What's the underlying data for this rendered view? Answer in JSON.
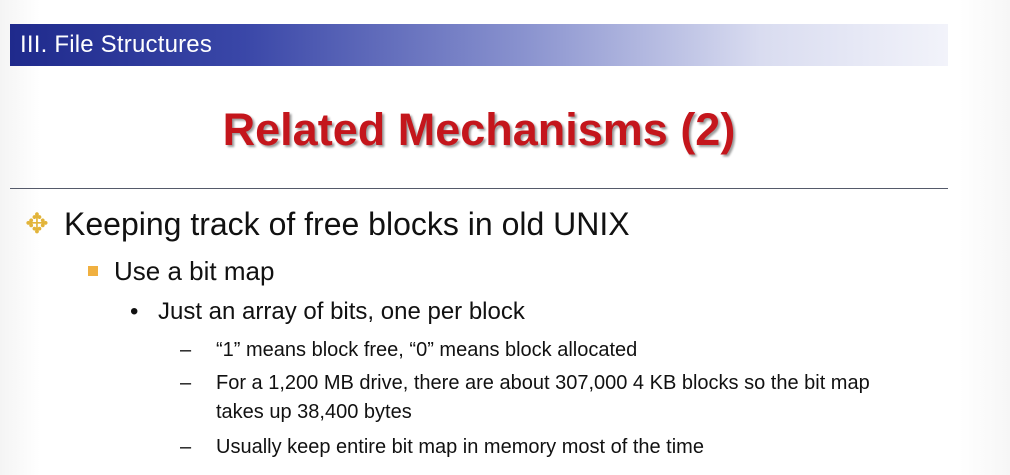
{
  "section": {
    "title": "III. File Structures"
  },
  "slide": {
    "title": "Related Mechanisms (2)"
  },
  "bullets": {
    "level1": "Keeping track of  free blocks in old UNIX",
    "level2": "Use a bit map",
    "level3": "Just an array of bits, one per block",
    "level4": [
      "“1” means block free, “0” means block allocated",
      "For a 1,200 MB drive, there are about 307,000 4 KB blocks so the bit map takes up 38,400 bytes",
      "Usually keep entire bit map in memory most of  the time"
    ]
  },
  "colors": {
    "title_red": "#c4161c",
    "section_bar_start": "#1f2a8c",
    "bullet_gold": "#e2b43a",
    "bullet_orange": "#f0b040"
  },
  "icons": {
    "level1_bullet": "four-diamond-star-icon",
    "level2_bullet": "square-bullet-icon",
    "level3_bullet": "dot-bullet-icon",
    "level4_bullet": "dash-bullet-icon"
  }
}
